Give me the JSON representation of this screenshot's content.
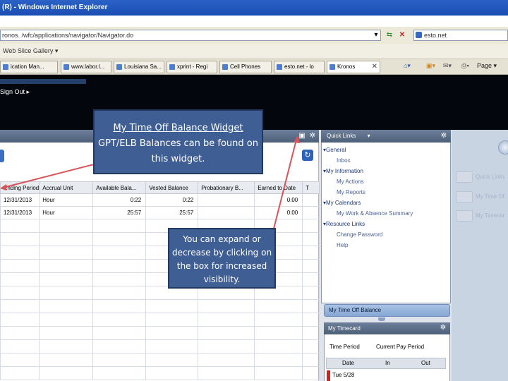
{
  "window": {
    "title": "(R) - Windows Internet Explorer"
  },
  "address_bar": {
    "url": "ronos.  /wfc/applications/navigator/Navigator.do",
    "search_value": "esto.net"
  },
  "favorites_bar": {
    "gallery_label": "Web Slice Gallery ▾"
  },
  "browser_tabs": [
    {
      "label": "ication Man..."
    },
    {
      "label": "www.labor.l..."
    },
    {
      "label": "Louisiana Sa..."
    },
    {
      "label": "xprint - Regi"
    },
    {
      "label": "Cell Phones"
    },
    {
      "label": "esto.net - lo"
    },
    {
      "label": "Kronos"
    }
  ],
  "browser_tools": {
    "page_label": "Page ▾"
  },
  "header": {
    "sign_out_label": "Sign Out ▸"
  },
  "balance_widget": {
    "columns": [
      "Ending Period",
      "Accrual Unit",
      "Available Bala...",
      "Vested Balance",
      "Probationary B...",
      "Earned to Date",
      "T"
    ],
    "rows": [
      {
        "period": "12/31/2013",
        "unit": "Hour",
        "available": "0:22",
        "vested": "0:22",
        "probationary": "",
        "earned": "0:00"
      },
      {
        "period": "12/31/2013",
        "unit": "Hour",
        "available": "25:57",
        "vested": "25:57",
        "probationary": "",
        "earned": "0:00"
      }
    ]
  },
  "quick_links": {
    "title": "Quick Links",
    "sections": [
      {
        "label": "General",
        "items": [
          "Inbox"
        ]
      },
      {
        "label": "My Information",
        "items": [
          "My Actions",
          "My Reports"
        ]
      },
      {
        "label": "My Calendars",
        "items": [
          "My Work & Absence Summary"
        ]
      },
      {
        "label": "Resource Links",
        "items": [
          "Change Password",
          "Help"
        ]
      }
    ]
  },
  "time_off_widget": {
    "title": "My Time Off Balance"
  },
  "timecard_widget": {
    "title": "My Timecard",
    "time_period_label": "Time Period",
    "current_pay_period_label": "Current Pay Period",
    "columns": [
      "Date",
      "In",
      "Out"
    ],
    "first_row_date": "Tue 5/28"
  },
  "right_nav": [
    "Quick Links",
    "My Time Of",
    "My Timecar"
  ],
  "callouts": {
    "widget_title": "My Time Off Balance Widget",
    "widget_text": "GPT/ELB Balances can be found on this widget.",
    "expand_text": "You can expand or decrease by clicking on the box for increased visibility."
  },
  "colors": {
    "callout_fill": "#3f5f94",
    "widget_header": "#5b6c87",
    "collapsed_widget": "#98b5dc",
    "arrow": "#d8545a"
  }
}
